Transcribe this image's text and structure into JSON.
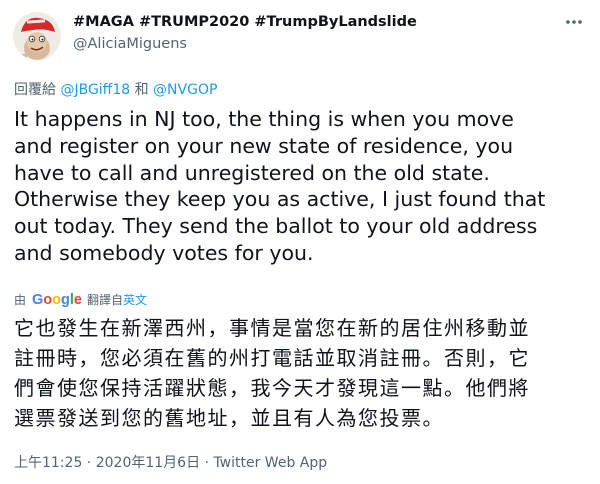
{
  "author": {
    "display_name": "#MAGA #TRUMP2020 #TrumpByLandslide",
    "handle": "@AliciaMiguens",
    "avatar_icon": "cartoon-avatar-red-cap"
  },
  "more_icon": "more-horizontal-icon",
  "reply": {
    "prefix": "回覆給",
    "mention_1": "@JBGiff18",
    "connector": "和",
    "mention_2": "@NVGOP"
  },
  "tweet": {
    "lines": [
      "It happens in NJ too, the thing is when you move",
      "and register on your new state of residence, you",
      "have to call and unregistered on the old state.",
      "Otherwise they keep you as active, I just found that",
      "out today. They send the ballot to your old address",
      "and somebody votes for you."
    ]
  },
  "translation": {
    "by_label": "由",
    "provider": "Google",
    "translated_from_label": "翻譯自",
    "source_language": "英文",
    "lines": [
      "它也發生在新澤西州，事情是當您在新的居住州移動並",
      "註冊時，您必須在舊的州打電話並取消註冊。否則，它",
      "們會使您保持活躍狀態，我今天才發現這一點。他們將",
      "選票發送到您的舊地址，並且有人為您投票。"
    ]
  },
  "meta": {
    "time": "上午11:25",
    "separator_1": " · ",
    "date": "2020年11月6日",
    "separator_2": " · ",
    "source": "Twitter Web App"
  },
  "colors": {
    "text": "#0f1419",
    "secondary": "#536471",
    "link": "#1d9bf0"
  }
}
